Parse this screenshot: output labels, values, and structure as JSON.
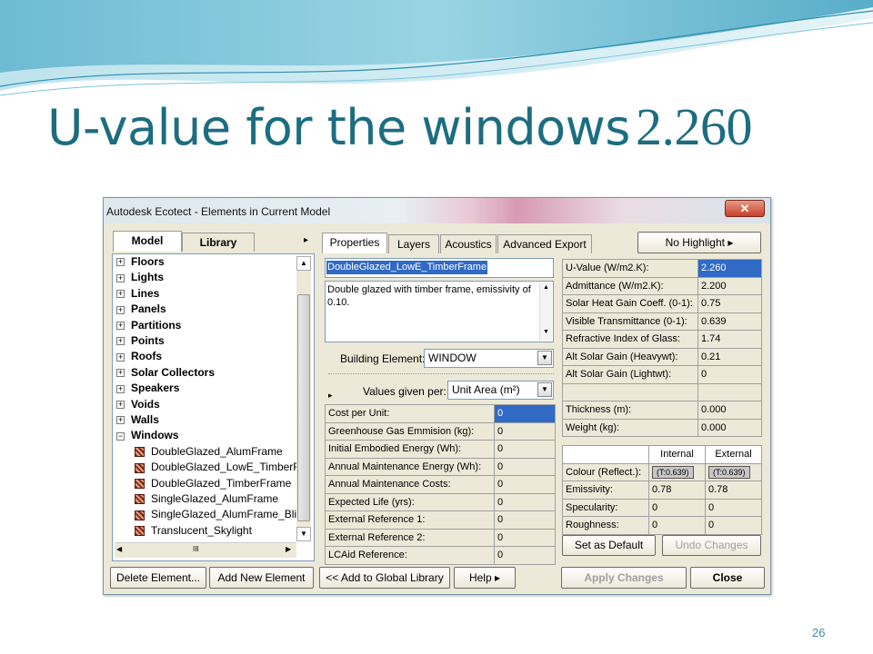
{
  "slide": {
    "title": "U-value for the windows",
    "title_value": "2.260",
    "page_number": "26"
  },
  "window": {
    "title": "Autodesk Ecotect - Elements in Current Model",
    "close_glyph": "✕"
  },
  "left_tabs": [
    {
      "label": "Model"
    },
    {
      "label": "Library"
    }
  ],
  "tab_scroll_glyph": "▸",
  "tree": {
    "categories": [
      "Floors",
      "Lights",
      "Lines",
      "Panels",
      "Partitions",
      "Points",
      "Roofs",
      "Solar Collectors",
      "Speakers",
      "Voids",
      "Walls",
      "Windows"
    ],
    "expanded_glyph": "−",
    "collapsed_glyph": "+",
    "window_items": [
      "DoubleGlazed_AlumFrame",
      "DoubleGlazed_LowE_TimberF",
      "DoubleGlazed_TimberFrame",
      "SingleGlazed_AlumFrame",
      "SingleGlazed_AlumFrame_Blir",
      "Translucent_Skylight"
    ],
    "hscroll_grip": "III"
  },
  "right_tabs": [
    {
      "label": "Properties"
    },
    {
      "label": "Layers"
    },
    {
      "label": "Acoustics"
    },
    {
      "label": "Advanced Export"
    }
  ],
  "highlight_button": "No Highlight ▸",
  "material": {
    "name": "DoubleGlazed_LowE_TimberFrame",
    "description": "Double glazed with timber frame, emissivity of 0.10.",
    "building_element_label": "Building Element:",
    "building_element_value": "WINDOW",
    "values_per_label": "Values given per:",
    "values_per_value": "Unit Area (m²)"
  },
  "cost_rows": [
    {
      "label": "Cost per Unit:",
      "value": "0"
    },
    {
      "label": "Greenhouse Gas Emmision (kg):",
      "value": "0"
    },
    {
      "label": "Initial Embodied Energy (Wh):",
      "value": "0"
    },
    {
      "label": "Annual Maintenance Energy (Wh):",
      "value": "0"
    },
    {
      "label": "Annual Maintenance Costs:",
      "value": "0"
    },
    {
      "label": "Expected Life (yrs):",
      "value": "0"
    },
    {
      "label": "External Reference 1:",
      "value": "0"
    },
    {
      "label": "External Reference 2:",
      "value": "0"
    },
    {
      "label": "LCAid Reference:",
      "value": "0"
    }
  ],
  "thermal_rows": [
    {
      "label": "U-Value (W/m2.K):",
      "value": "2.260"
    },
    {
      "label": "Admittance (W/m2.K):",
      "value": "2.200"
    },
    {
      "label": "Solar Heat Gain Coeff. (0-1):",
      "value": "0.75"
    },
    {
      "label": "Visible Transmittance (0-1):",
      "value": "0.639"
    },
    {
      "label": "Refractive Index of Glass:",
      "value": "1.74"
    },
    {
      "label": "Alt Solar Gain (Heavywt):",
      "value": "0.21"
    },
    {
      "label": "Alt Solar Gain (Lightwt):",
      "value": "0"
    },
    {
      "label": "",
      "value": ""
    },
    {
      "label": "Thickness (m):",
      "value": "0.000"
    },
    {
      "label": "Weight (kg):",
      "value": "0.000"
    }
  ],
  "surface": {
    "headers": [
      "",
      "Internal",
      "External"
    ],
    "rows": [
      {
        "label": "Colour (Reflect.):",
        "internal": "(T:0.639)",
        "external": "(T:0.639)"
      },
      {
        "label": "Emissivity:",
        "internal": "0.78",
        "external": "0.78"
      },
      {
        "label": "Specularity:",
        "internal": "0",
        "external": "0"
      },
      {
        "label": "Roughness:",
        "internal": "0",
        "external": "0"
      }
    ]
  },
  "buttons": {
    "set_default": "Set as Default",
    "undo": "Undo Changes",
    "delete": "Delete Element...",
    "add_new": "Add New Element",
    "add_global": "<< Add to Global Library",
    "help": "Help ▸",
    "apply": "Apply Changes",
    "close": "Close"
  },
  "colors": {
    "title": "#1c6d80",
    "selection": "#316ac5",
    "dialog_bg": "#ece9d8"
  }
}
